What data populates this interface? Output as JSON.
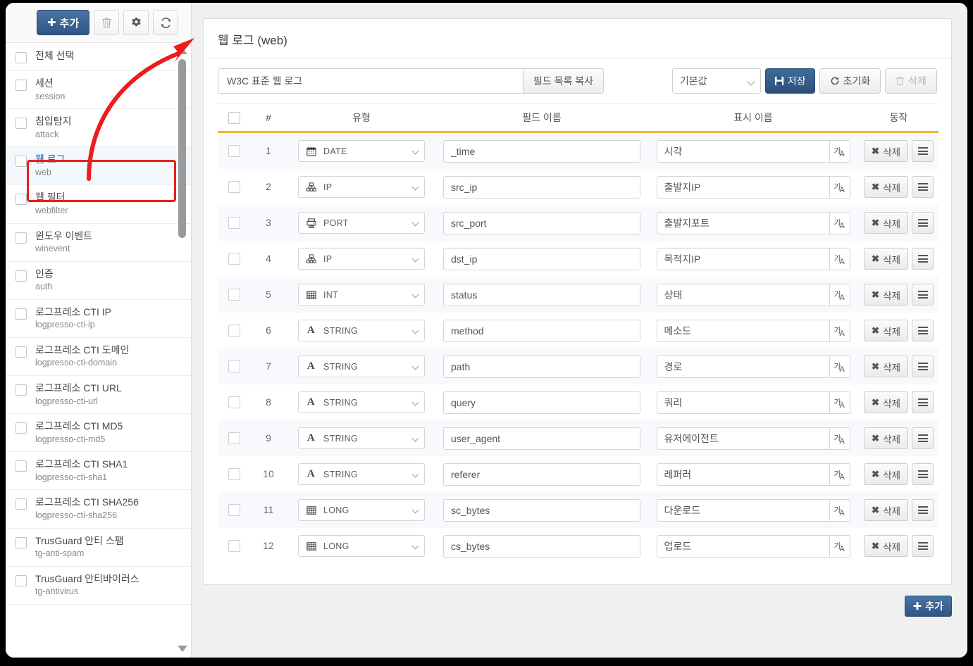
{
  "sidebar": {
    "toolbar": {
      "add_label": "추가",
      "add_icon": "plus-icon",
      "delete_icon": "trash-icon",
      "settings_icon": "gear-icon",
      "refresh_icon": "refresh-icon"
    },
    "select_all_label": "전체 선택",
    "items": [
      {
        "name": "세션",
        "code": "session"
      },
      {
        "name": "침입탐지",
        "code": "attack"
      },
      {
        "name": "웹 로그",
        "code": "web",
        "selected": true
      },
      {
        "name": "웹 필터",
        "code": "webfilter"
      },
      {
        "name": "윈도우 이벤트",
        "code": "winevent"
      },
      {
        "name": "인증",
        "code": "auth"
      },
      {
        "name": "로그프레소 CTI IP",
        "code": "logpresso-cti-ip"
      },
      {
        "name": "로그프레소 CTI 도메인",
        "code": "logpresso-cti-domain"
      },
      {
        "name": "로그프레소 CTI URL",
        "code": "logpresso-cti-url"
      },
      {
        "name": "로그프레소 CTI MD5",
        "code": "logpresso-cti-md5"
      },
      {
        "name": "로그프레소 CTI SHA1",
        "code": "logpresso-cti-sha1"
      },
      {
        "name": "로그프레소 CTI SHA256",
        "code": "logpresso-cti-sha256"
      },
      {
        "name": "TrusGuard 안티 스팸",
        "code": "tg-anti-spam"
      },
      {
        "name": "TrusGuard 안티바이러스",
        "code": "tg-antivirus"
      }
    ]
  },
  "main": {
    "title": "웹 로그 (web)",
    "description_value": "W3C 표준 웹 로그",
    "copy_fields_label": "필드 목록 복사",
    "preset_value": "기본값",
    "save_label": "저장",
    "reset_label": "초기화",
    "delete_label": "삭제",
    "add_label": "추가",
    "columns": {
      "number": "#",
      "type": "유형",
      "field_name": "필드 이름",
      "display_name": "표시 이름",
      "action": "동작"
    },
    "row_delete_label": "삭제",
    "rows": [
      {
        "num": "1",
        "type": "DATE",
        "icon": "calendar-icon",
        "field": "_time",
        "display": "시각"
      },
      {
        "num": "2",
        "type": "IP",
        "icon": "network-icon",
        "field": "src_ip",
        "display": "출발지IP"
      },
      {
        "num": "3",
        "type": "PORT",
        "icon": "server-icon",
        "field": "src_port",
        "display": "출발지포트"
      },
      {
        "num": "4",
        "type": "IP",
        "icon": "network-icon",
        "field": "dst_ip",
        "display": "목적지IP"
      },
      {
        "num": "5",
        "type": "INT",
        "icon": "grid-icon",
        "field": "status",
        "display": "상태"
      },
      {
        "num": "6",
        "type": "STRING",
        "icon": "letter-a-icon",
        "field": "method",
        "display": "메소드"
      },
      {
        "num": "7",
        "type": "STRING",
        "icon": "letter-a-icon",
        "field": "path",
        "display": "경로"
      },
      {
        "num": "8",
        "type": "STRING",
        "icon": "letter-a-icon",
        "field": "query",
        "display": "쿼리"
      },
      {
        "num": "9",
        "type": "STRING",
        "icon": "letter-a-icon",
        "field": "user_agent",
        "display": "유저에이전트"
      },
      {
        "num": "10",
        "type": "STRING",
        "icon": "letter-a-icon",
        "field": "referer",
        "display": "레퍼러"
      },
      {
        "num": "11",
        "type": "LONG",
        "icon": "grid-icon",
        "field": "sc_bytes",
        "display": "다운로드"
      },
      {
        "num": "12",
        "type": "LONG",
        "icon": "grid-icon",
        "field": "cs_bytes",
        "display": "업로드"
      }
    ]
  },
  "annotation": {
    "color": "#ee1c1c",
    "highlight_target": "web"
  },
  "colors": {
    "primary": "#2f5584",
    "accent_underline": "#f0b429",
    "selected_row_bg": "#f3f8fd",
    "stripe_bg": "#f8f9fc",
    "annotation_red": "#ee1c1c"
  }
}
